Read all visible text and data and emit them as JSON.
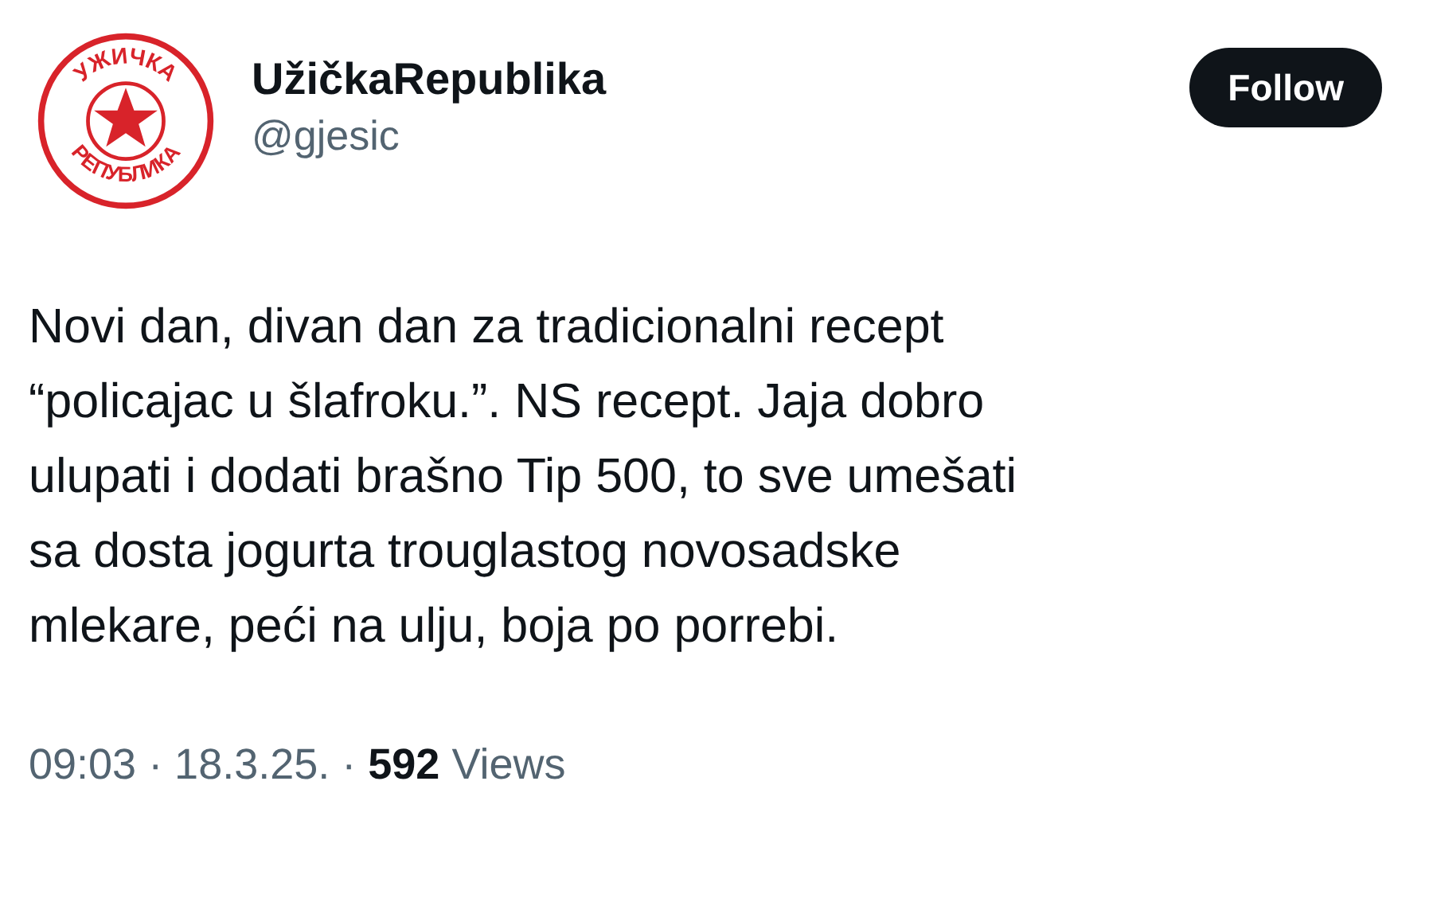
{
  "author": {
    "avatar_top_text": "УЖИЧКА",
    "avatar_bottom_text": "РЕПУБЛИКА",
    "name": "UžičkaRepublika",
    "handle": "@gjesic"
  },
  "follow_button": "Follow",
  "tweet_lines": [
    "Novi dan, divan dan za tradicionalni recept",
    "“policajac u šlafroku.”. NS recept. Jaja dobro",
    "ulupati i dodati brašno Tip 500, to sve umešati",
    "sa dosta jogurta trouglastog novosadske",
    "mlekare, peći na ulju, boja po porrebi."
  ],
  "meta": "09:03 · 18.3.25. · **592** Views"
}
